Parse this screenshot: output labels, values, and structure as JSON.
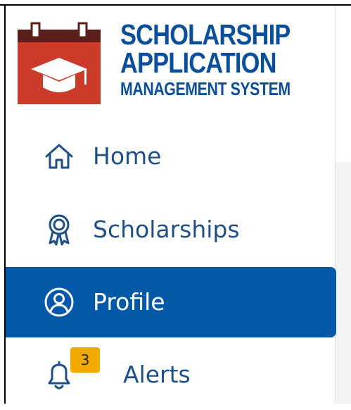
{
  "brand": {
    "line1": "Scholarship",
    "line2": "Application",
    "line3": "Management System",
    "colors": {
      "blue": "#0b4f9c",
      "red": "#cc3a2a",
      "dark": "#5a1f1a"
    }
  },
  "nav": {
    "items": [
      {
        "label": "Home",
        "icon": "home-icon",
        "active": false
      },
      {
        "label": "Scholarships",
        "icon": "award-ribbon-icon",
        "active": false
      },
      {
        "label": "Profile",
        "icon": "user-circle-icon",
        "active": true
      },
      {
        "label": "Alerts",
        "icon": "bell-icon",
        "active": false,
        "badge": "3"
      }
    ],
    "colors": {
      "active_bg": "#0458a8",
      "label": "#1f4f87",
      "badge_bg": "#f2a900"
    }
  }
}
